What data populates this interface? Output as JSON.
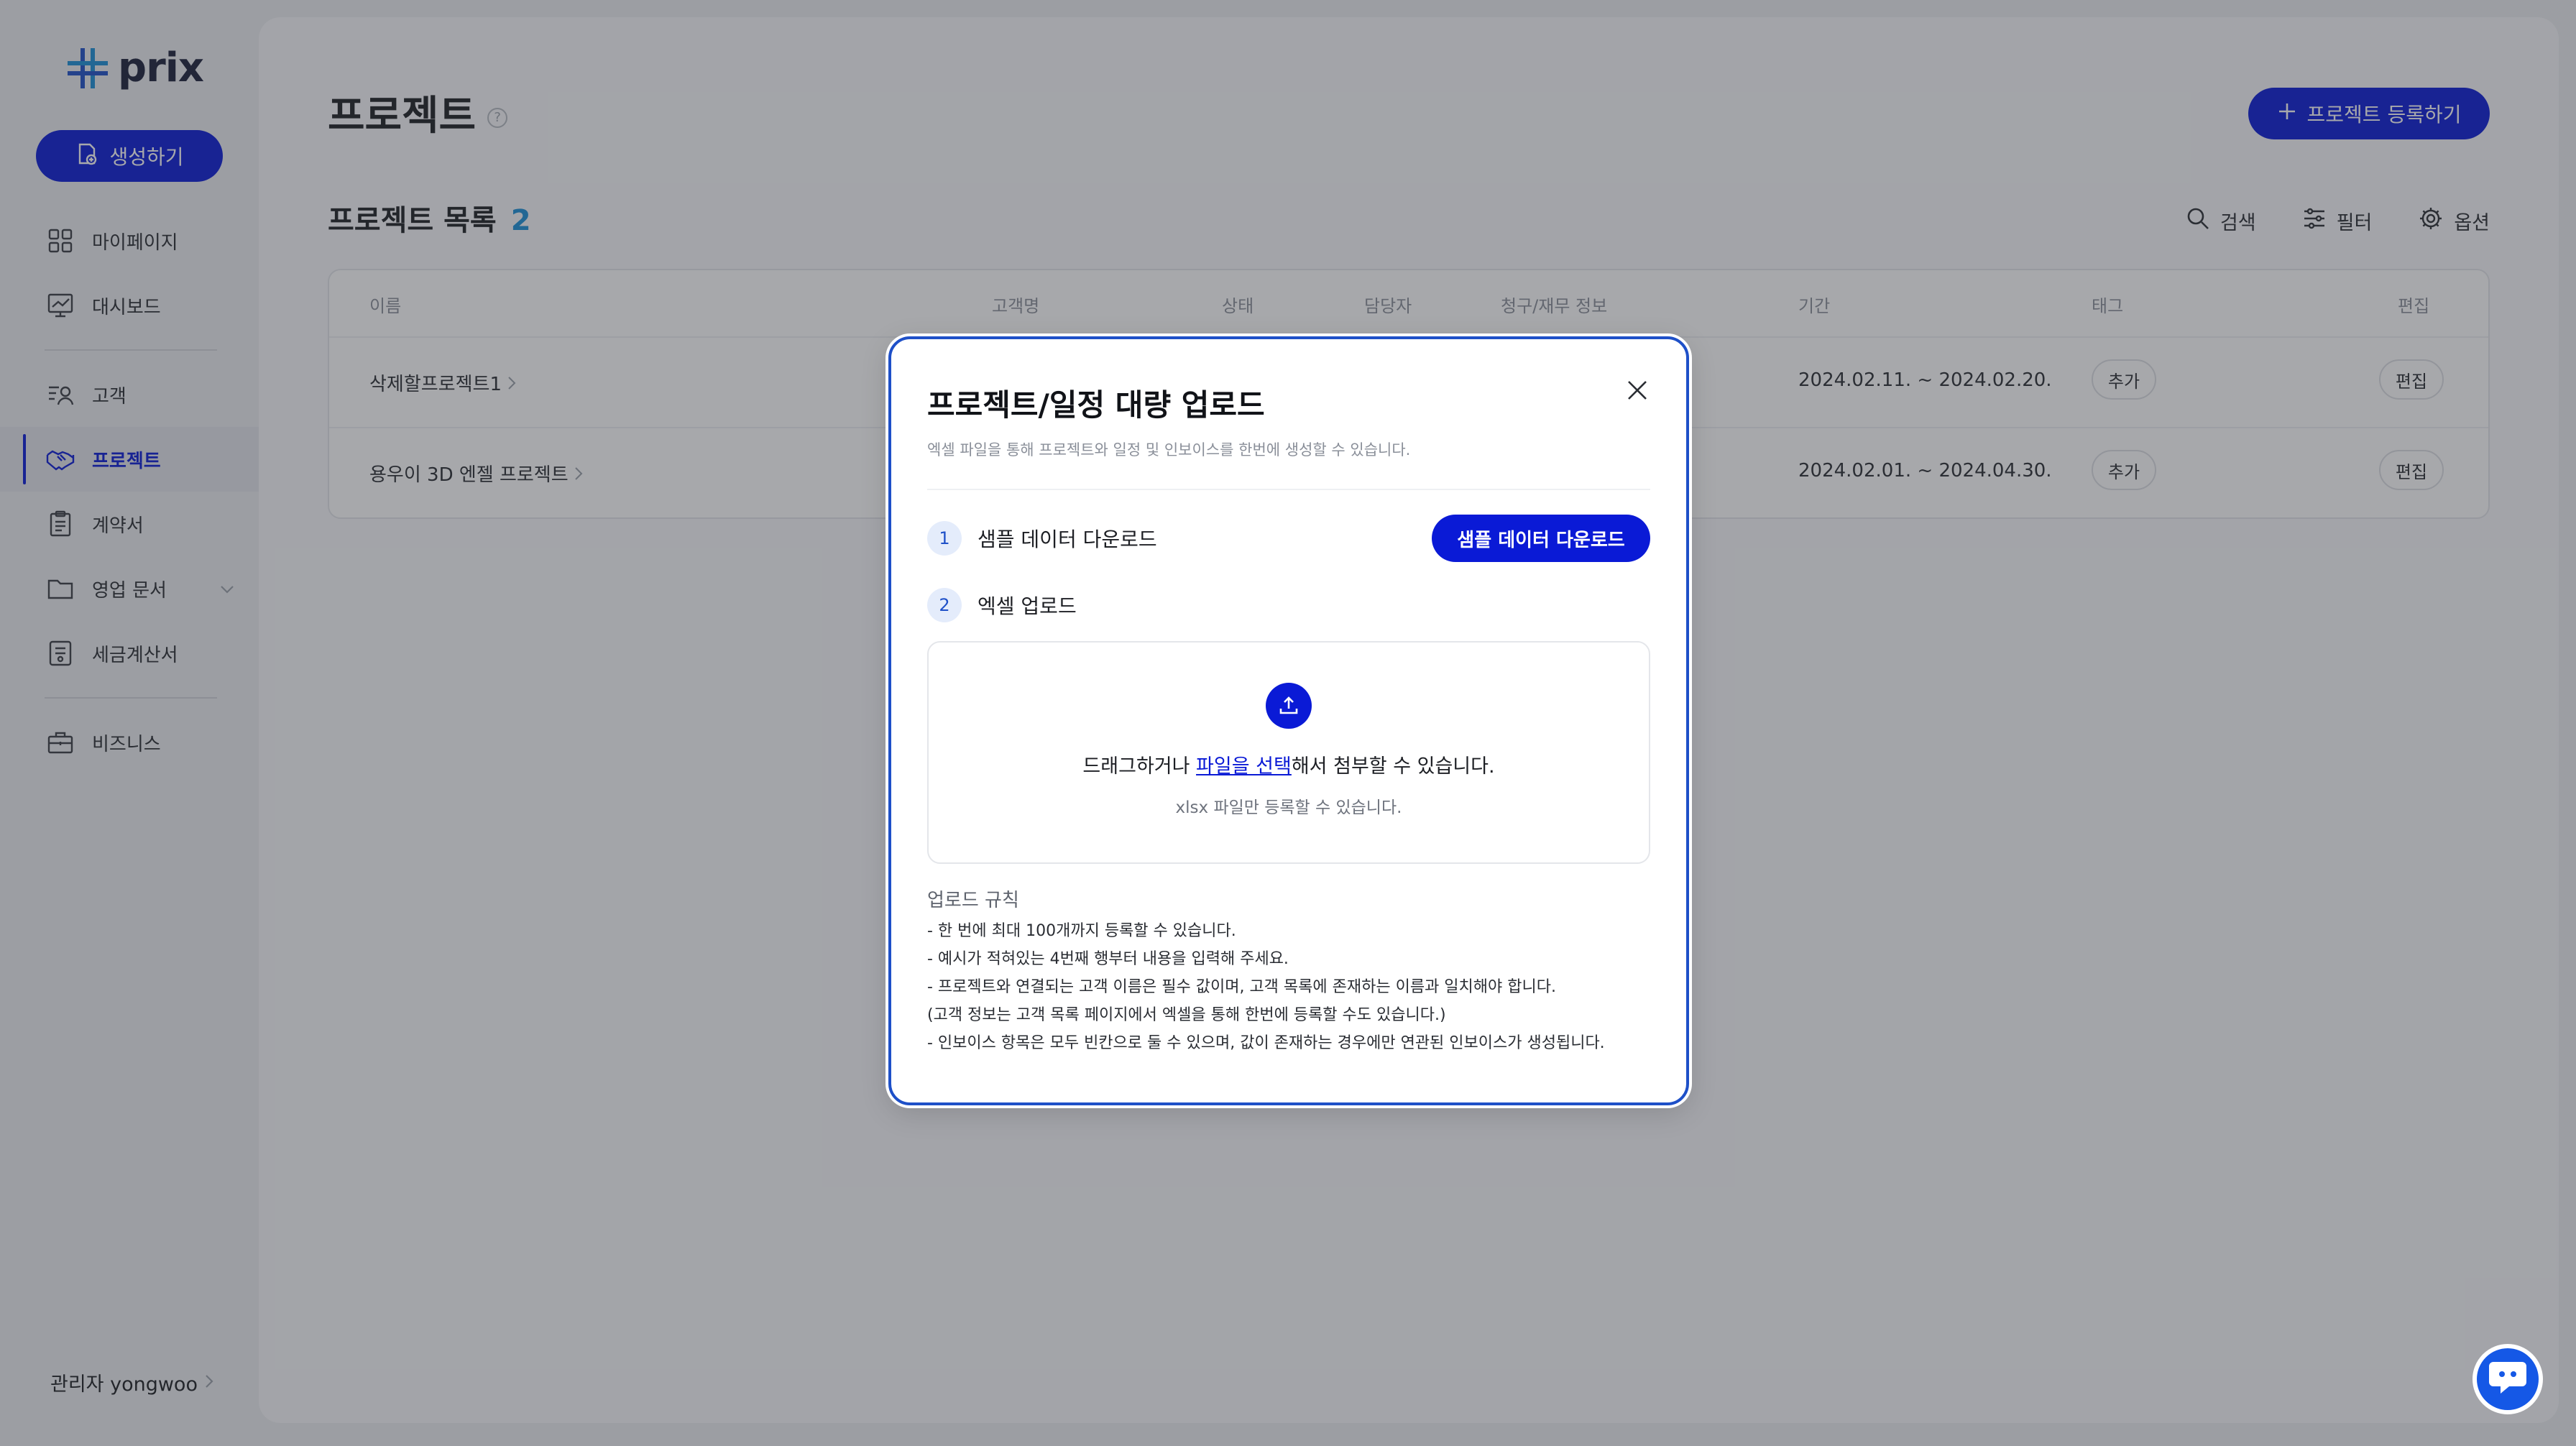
{
  "app": {
    "logo": "prix"
  },
  "sidebar": {
    "create_label": "생성하기",
    "items": [
      {
        "label": "마이페이지",
        "icon": "grid-icon"
      },
      {
        "label": "대시보드",
        "icon": "dashboard-icon"
      },
      {
        "label": "고객",
        "icon": "customer-icon"
      },
      {
        "label": "프로젝트",
        "icon": "handshake-icon",
        "active": true
      },
      {
        "label": "계약서",
        "icon": "contract-icon"
      },
      {
        "label": "영업 문서",
        "icon": "folder-icon"
      },
      {
        "label": "세금계산서",
        "icon": "tax-invoice-icon"
      },
      {
        "label": "비즈니스",
        "icon": "briefcase-icon"
      }
    ],
    "admin_label": "관리자 yongwoo"
  },
  "main": {
    "title": "프로젝트",
    "register_label": "프로젝트 등록하기",
    "list_title": "프로젝트 목록",
    "list_count": "2",
    "tools": {
      "search": "검색",
      "filter": "필터",
      "options": "옵션"
    },
    "table": {
      "headers": [
        "이름",
        "고객명",
        "상태",
        "담당자",
        "청구/재무 정보",
        "기간",
        "태그",
        "편집"
      ],
      "rows": [
        {
          "name": "삭제할프로젝트1",
          "period": "2024.02.11. ~ 2024.02.20.",
          "tag": "추가",
          "edit": "편집"
        },
        {
          "name": "용우이 3D 엔젤 프로젝트",
          "period": "2024.02.01. ~ 2024.04.30.",
          "tag": "추가",
          "edit": "편집"
        }
      ]
    }
  },
  "modal": {
    "title": "프로젝트/일정 대량 업로드",
    "subtitle": "엑셀 파일을 통해 프로젝트와 일정 및 인보이스를 한번에 생성할 수 있습니다.",
    "step1": {
      "num": "1",
      "label": "샘플 데이터 다운로드"
    },
    "step2": {
      "num": "2",
      "label": "엑셀 업로드"
    },
    "sample_button": "샘플 데이터 다운로드",
    "drop_prefix": "드래그하거나 ",
    "drop_link": "파일을 선택",
    "drop_suffix": "해서 첨부할 수 있습니다.",
    "drop_hint": "xlsx 파일만 등록할 수 있습니다.",
    "rules_title": "업로드 규칙",
    "rules": [
      "- 한 번에 최대 100개까지 등록할 수 있습니다.",
      "- 예시가 적혀있는 4번째 행부터 내용을 입력해 주세요.",
      "- 프로젝트와 연결되는 고객 이름은 필수 값이며, 고객 목록에 존재하는 이름과 일치해야 합니다.",
      "(고객 정보는 고객 목록 페이지에서 엑셀을 통해 한번에 등록할 수도 있습니다.)",
      "- 인보이스 항목은 모두 빈칸으로 둘 수 있으며, 값이 존재하는 경우에만 연관된 인보이스가 생성됩니다."
    ]
  },
  "colors": {
    "accent": "#0a1ad6",
    "count": "#1b8fd8",
    "modal_border": "#1e50c8"
  }
}
